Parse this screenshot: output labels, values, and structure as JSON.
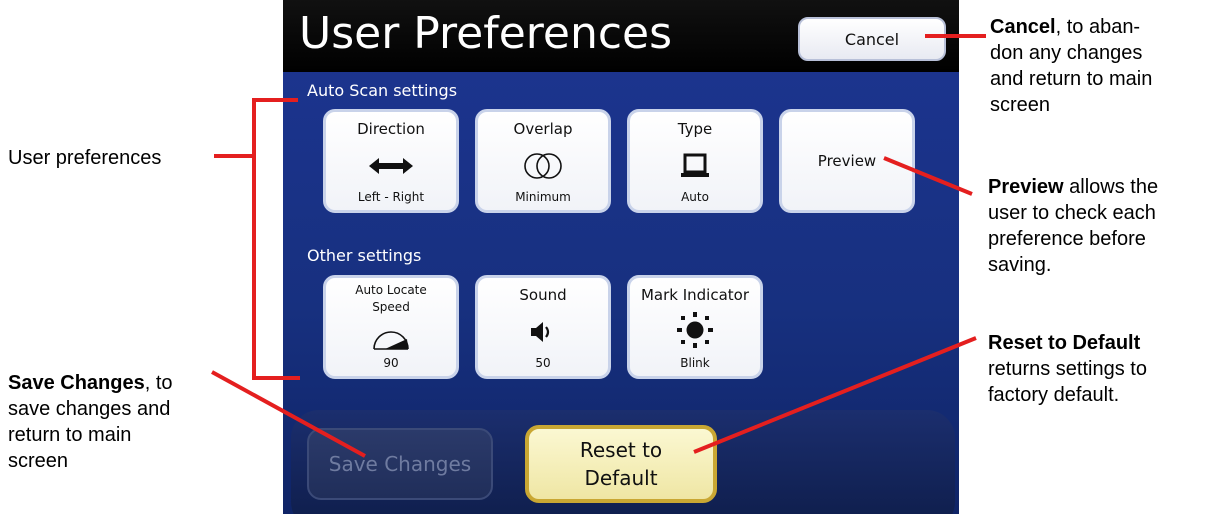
{
  "screen": {
    "title": "User Preferences",
    "cancel_label": "Cancel",
    "auto_scan_label": "Auto Scan settings",
    "other_settings_label": "Other settings",
    "auto_scan_tiles": [
      {
        "label": "Direction",
        "value": "Left - Right",
        "icon": "double-arrow-icon"
      },
      {
        "label": "Overlap",
        "value": "Minimum",
        "icon": "overlap-circles-icon"
      },
      {
        "label": "Type",
        "value": "Auto",
        "icon": "laptop-icon"
      },
      {
        "label": "Preview",
        "value": "",
        "icon": ""
      }
    ],
    "other_tiles": [
      {
        "label_line1": "Auto Locate",
        "label_line2": "Speed",
        "value": "90",
        "icon": "speed-gauge-icon"
      },
      {
        "label": "Sound",
        "value": "50",
        "icon": "speaker-icon"
      },
      {
        "label": "Mark Indicator",
        "value": "Blink",
        "icon": "sun-icon"
      }
    ],
    "save_label": "Save Changes",
    "reset_line1": "Reset to",
    "reset_line2": "Default"
  },
  "annotations": {
    "cancel": {
      "bold": "Cancel",
      "text_line1": ", to aban-",
      "text_line2": "don any changes",
      "text_line3": "and return to main",
      "text_line4": "screen"
    },
    "user_prefs": {
      "text": "User preferences"
    },
    "preview": {
      "bold": "Preview",
      "text_line1": " allows the",
      "text_line2": "user to check each",
      "text_line3": "preference before",
      "text_line4": "saving."
    },
    "reset": {
      "bold": "Reset to Default",
      "text_line2": "returns settings to",
      "text_line3": "factory default."
    },
    "save": {
      "bold": "Save Changes",
      "text_line1": ", to",
      "text_line2": "save changes and",
      "text_line3": "return to main",
      "text_line4": "screen"
    }
  },
  "colors": {
    "callout_line": "#e41f1f",
    "screen_bg": "#1d3592",
    "reset_border": "#c9a733"
  }
}
